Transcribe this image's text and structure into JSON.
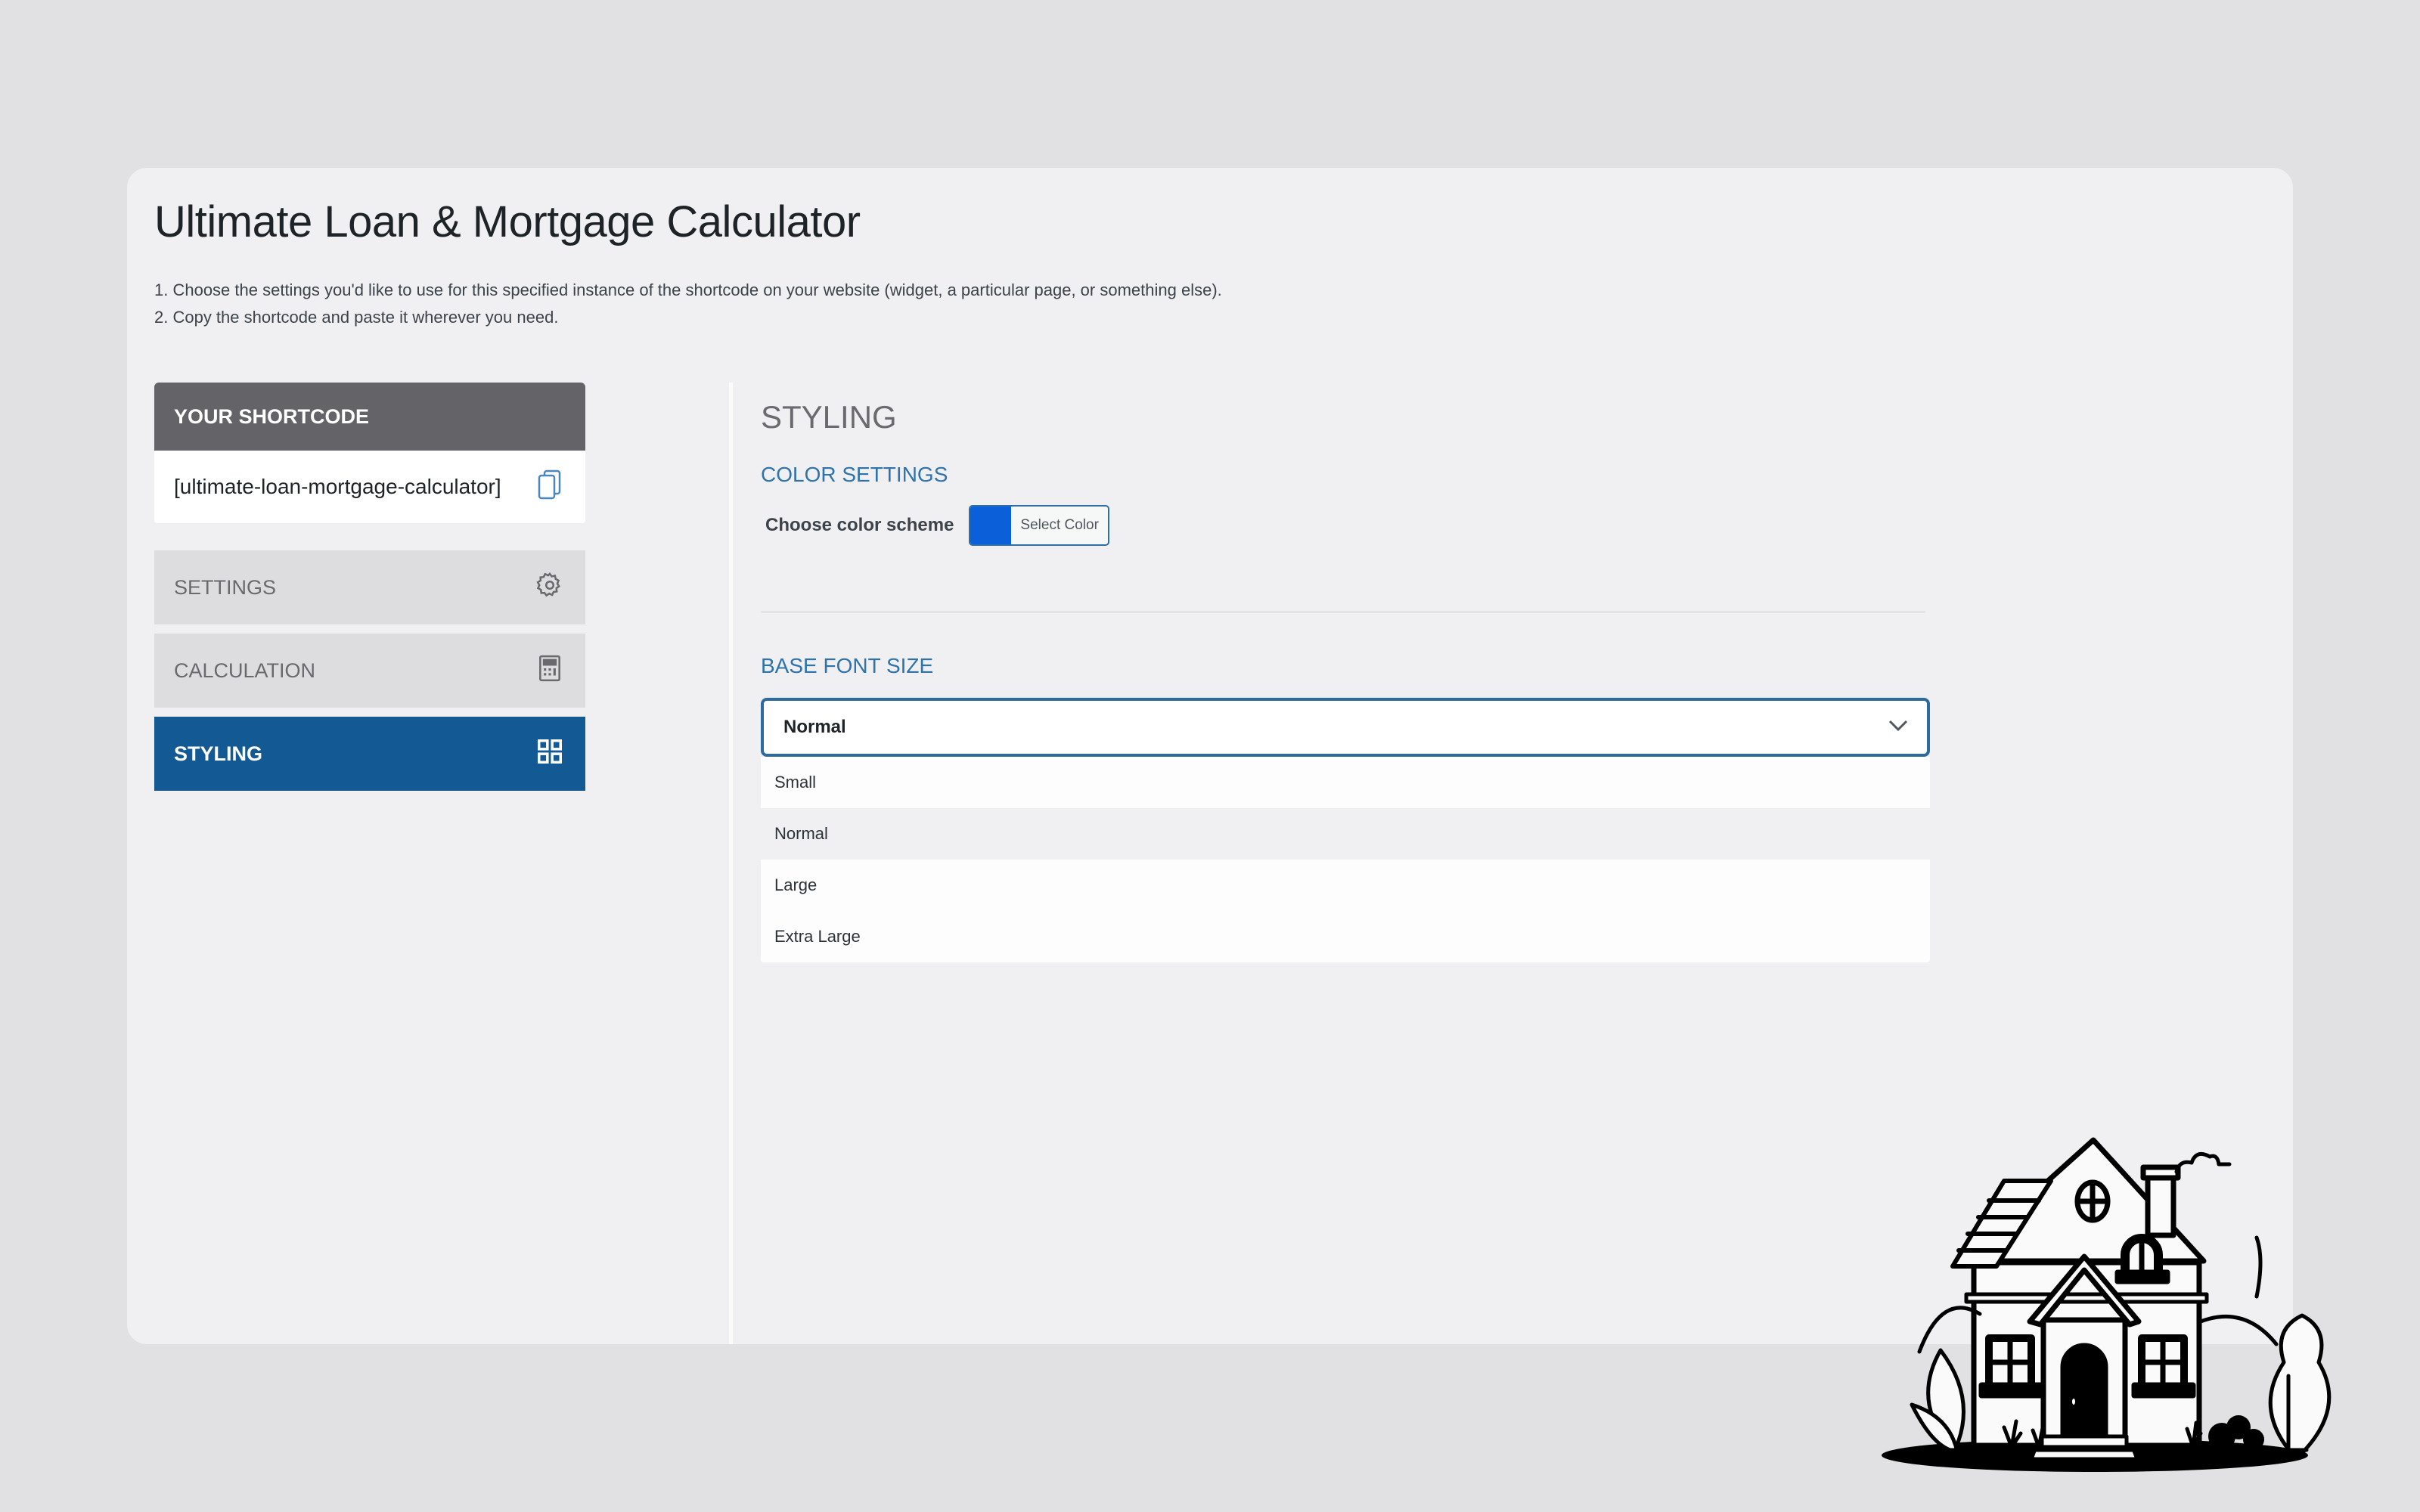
{
  "page": {
    "title": "Ultimate Loan & Mortgage Calculator",
    "instructions": [
      "1. Choose the settings you'd like to use for this specified instance of the shortcode on your website (widget, a particular page, or something else).",
      "2. Copy the shortcode and paste it wherever you need."
    ]
  },
  "sidebar": {
    "shortcode_header": "YOUR SHORTCODE",
    "shortcode_value": "[ultimate-loan-mortgage-calculator]",
    "copy_icon": "copy-icon",
    "items": [
      {
        "label": "SETTINGS",
        "icon": "gear-icon",
        "active": false
      },
      {
        "label": "CALCULATION",
        "icon": "calculator-icon",
        "active": false
      },
      {
        "label": "STYLING",
        "icon": "grid-icon",
        "active": true
      }
    ]
  },
  "main": {
    "section_title": "STYLING",
    "color_settings": {
      "heading": "COLOR SETTINGS",
      "label": "Choose color scheme",
      "button_label": "Select Color",
      "selected_color": "#0b5fd9"
    },
    "font_size": {
      "heading": "BASE FONT SIZE",
      "selected": "Normal",
      "options": [
        "Small",
        "Normal",
        "Large",
        "Extra Large"
      ],
      "highlighted_option": "Normal"
    }
  },
  "colors": {
    "accent": "#135a95",
    "heading_blue": "#2d73ad",
    "shortcode_header_bg": "#646367"
  },
  "illustration": "house-illustration"
}
